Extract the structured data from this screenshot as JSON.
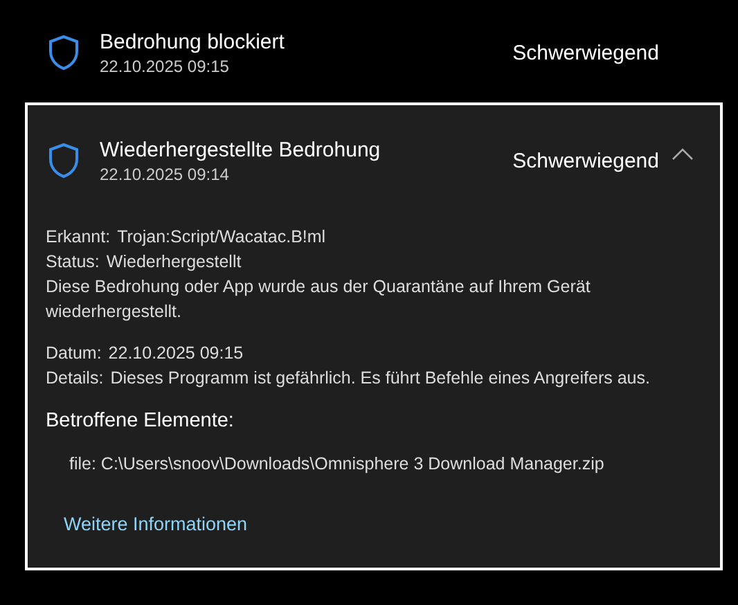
{
  "threats": [
    {
      "title": "Bedrohung blockiert",
      "date": "22.10.2025 09:15",
      "severity": "Schwerwiegend",
      "expanded": false
    },
    {
      "title": "Wiederhergestellte Bedrohung",
      "date": "22.10.2025 09:14",
      "severity": "Schwerwiegend",
      "expanded": true,
      "details": {
        "fields": [
          {
            "label": "Erkannt:",
            "value": "Trojan:Script/Wacatac.B!ml"
          },
          {
            "label": "Status:",
            "value": "Wiederhergestellt"
          }
        ],
        "description": "Diese Bedrohung oder App wurde aus der Quarantäne auf Ihrem Gerät wiederhergestellt.",
        "more_fields": [
          {
            "label": "Datum:",
            "value": "22.10.2025 09:15"
          },
          {
            "label": "Details:",
            "value": "Dieses Programm ist gefährlich. Es führt Befehle eines Angreifers aus."
          }
        ],
        "affected_heading": "Betroffene Elemente:",
        "affected_items": [
          "file: C:\\Users\\snoov\\Downloads\\Omnisphere 3 Download Manager.zip"
        ],
        "link": "Weitere Informationen"
      }
    }
  ]
}
